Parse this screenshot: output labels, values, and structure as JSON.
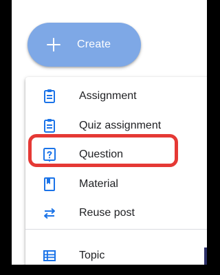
{
  "create_button": {
    "label": "Create",
    "icon": "plus-icon"
  },
  "menu": {
    "items": [
      {
        "label": "Assignment",
        "icon": "clipboard-assignment-icon"
      },
      {
        "label": "Quiz assignment",
        "icon": "clipboard-quiz-icon"
      },
      {
        "label": "Question",
        "icon": "question-box-icon"
      },
      {
        "label": "Material",
        "icon": "bookmark-material-icon"
      },
      {
        "label": "Reuse post",
        "icon": "repeat-arrows-icon"
      },
      {
        "label": "Topic",
        "icon": "topic-list-icon"
      }
    ],
    "highlighted_item": "Question"
  },
  "colors": {
    "accent": "#1a73e8",
    "create_button_bg": "#7ea8e6",
    "highlight_border": "#e53935"
  }
}
